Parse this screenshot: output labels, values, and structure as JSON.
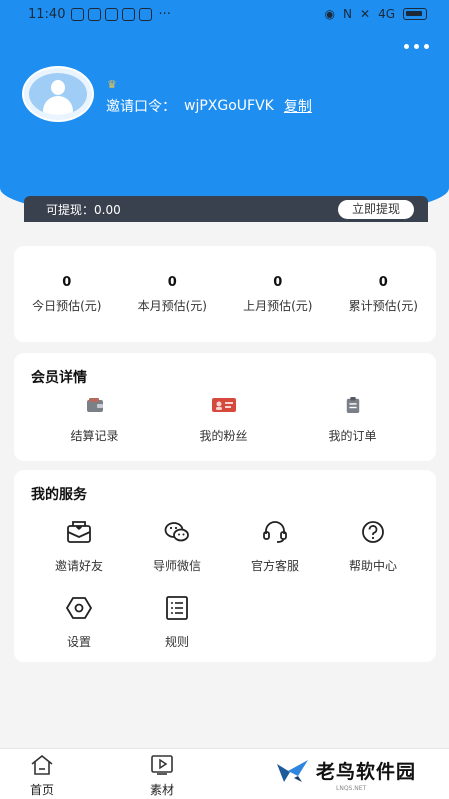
{
  "status_bar": {
    "time": "11:40",
    "dots": "···",
    "network": "4G"
  },
  "profile": {
    "invite_label": "邀请口令：",
    "invite_code": "wjPXGoUFVK",
    "copy_label": "复制"
  },
  "withdraw": {
    "label": "可提现：0.00",
    "button": "立即提现"
  },
  "stats": [
    {
      "value": "0",
      "label": "今日预估(元)"
    },
    {
      "value": "0",
      "label": "本月预估(元)"
    },
    {
      "value": "0",
      "label": "上月预估(元)"
    },
    {
      "value": "0",
      "label": "累计预估(元)"
    }
  ],
  "member": {
    "title": "会员详情",
    "items": [
      {
        "label": "结算记录",
        "icon": "wallet-icon"
      },
      {
        "label": "我的粉丝",
        "icon": "id-card-icon"
      },
      {
        "label": "我的订单",
        "icon": "clipboard-icon"
      }
    ]
  },
  "services": {
    "title": "我的服务",
    "items": [
      {
        "label": "邀请好友",
        "icon": "envelope-icon"
      },
      {
        "label": "导师微信",
        "icon": "wechat-icon"
      },
      {
        "label": "官方客服",
        "icon": "headset-icon"
      },
      {
        "label": "帮助中心",
        "icon": "help-icon"
      },
      {
        "label": "设置",
        "icon": "settings-icon"
      },
      {
        "label": "规则",
        "icon": "rules-icon"
      }
    ]
  },
  "tabs": [
    {
      "label": "首页",
      "icon": "home-icon"
    },
    {
      "label": "素材",
      "icon": "play-icon"
    }
  ],
  "watermark": {
    "text": "老鸟软件园",
    "sub": "LNQS.NET"
  },
  "colors": {
    "header": "#1e8ef0",
    "withdraw_bar": "#3a414e",
    "crown": "#f0c64a"
  }
}
